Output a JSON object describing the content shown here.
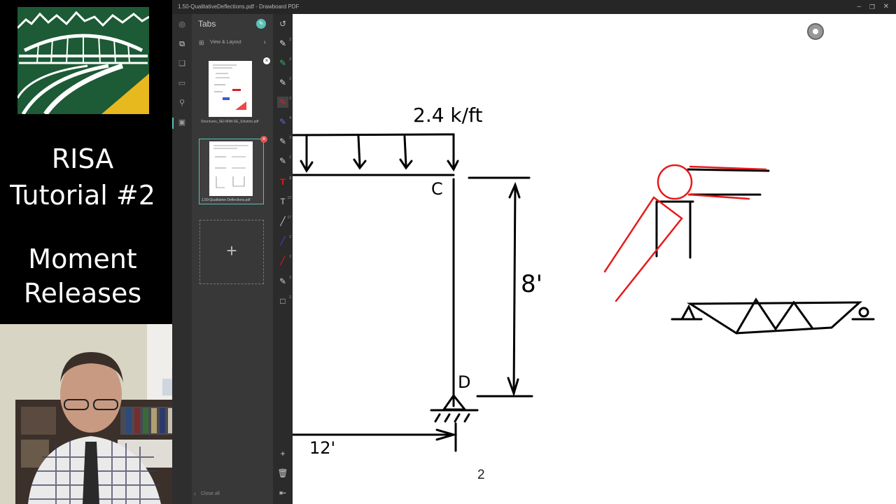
{
  "title_panel": {
    "line1": "RISA",
    "line2": "Tutorial #2",
    "line3": "Moment",
    "line4": "Releases"
  },
  "app": {
    "window_title": "1.50-QualitativeDeflections.pdf - Drawboard PDF",
    "tabs_header": "Tabs",
    "view_layout": "View & Layout",
    "tab1_name": "Structures_SEI-MIM-SE_Solution.pdf",
    "tab2_name": "1.50-Qualitative Deflections.pdf",
    "add_tab": "+",
    "close_all": "Close all",
    "page_number": "2",
    "pen_counts": [
      "2",
      "2",
      "2",
      "2",
      "4",
      "2",
      "2",
      "2",
      "12",
      "17",
      "2",
      "2",
      "2",
      "2",
      "1"
    ]
  },
  "drawing": {
    "load_label": "2.4 k/ft",
    "node_c": "C",
    "node_d": "D",
    "height_label": "8'",
    "span_label": "12'"
  },
  "colors": {
    "logo_green": "#1d5a36",
    "logo_yellow": "#e8b81f",
    "ink_red": "#e8191b",
    "accent_teal": "#5bc0b5"
  }
}
